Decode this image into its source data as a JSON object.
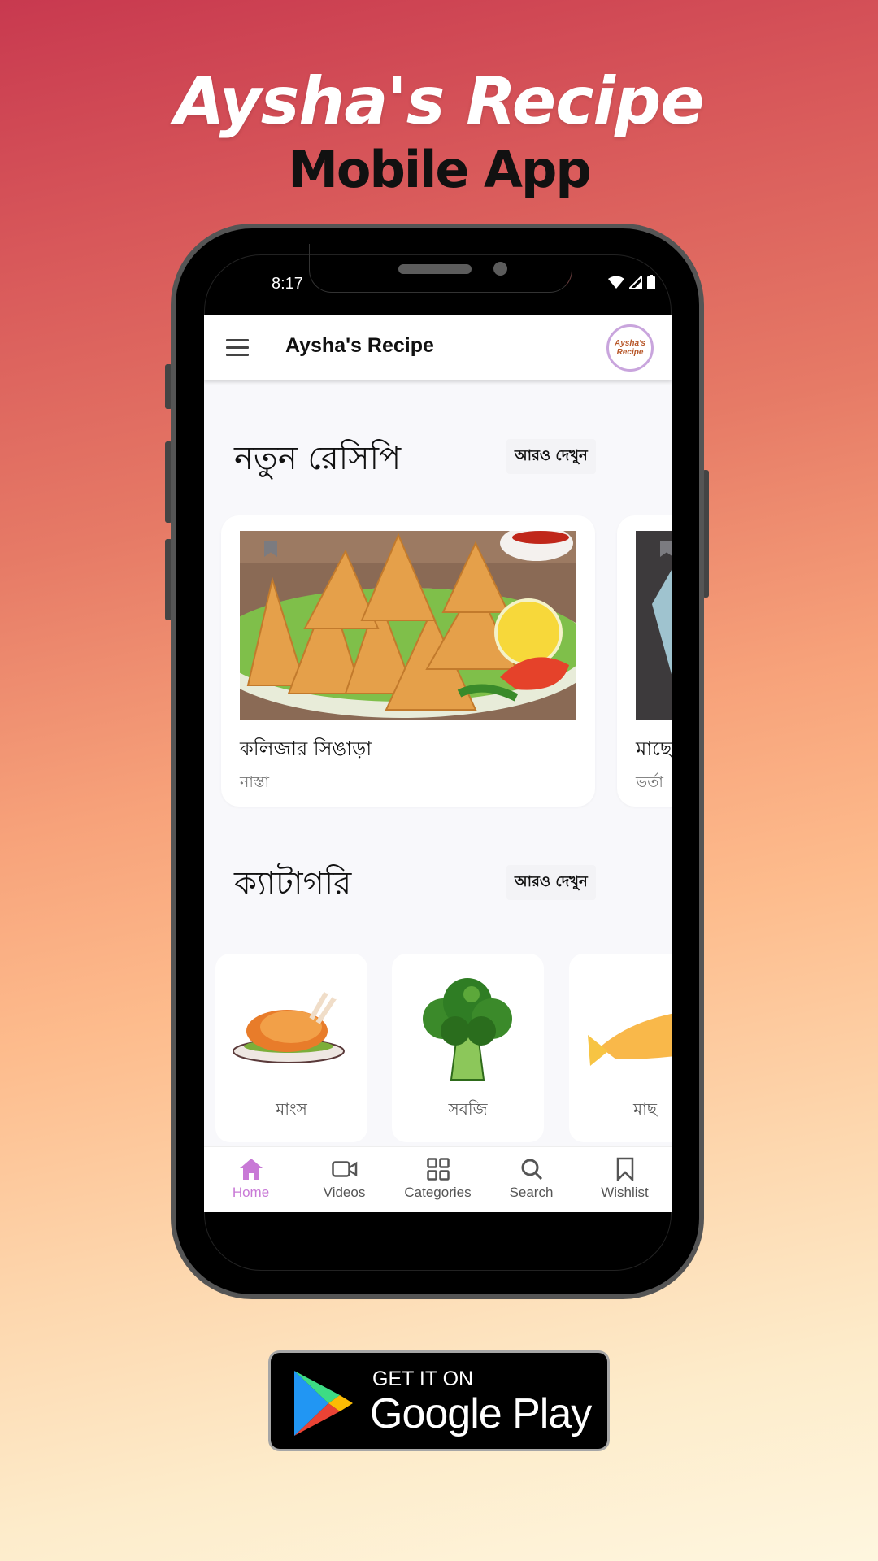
{
  "promo": {
    "title": "Aysha's Recipe",
    "subtitle": "Mobile App"
  },
  "status_bar": {
    "time": "8:17",
    "icons": [
      "wifi-icon",
      "signal-icon",
      "battery-icon"
    ]
  },
  "app_bar": {
    "menu_icon": "hamburger-menu-icon",
    "title": "Aysha's Recipe",
    "logo_line1": "Aysha's",
    "logo_line2": "Recipe"
  },
  "new_recipes": {
    "title": "নতুন রেসিপি",
    "see_more": "আরও দেখুন",
    "items": [
      {
        "name": "কলিজার সিঙাড়া",
        "category": "নাস্তা"
      },
      {
        "name": "মাছে",
        "category": "ভর্তা"
      }
    ]
  },
  "categories": {
    "title": "ক্যাটাগরি",
    "see_more": "আরও দেখুন",
    "items": [
      {
        "label": "মাংস",
        "icon": "roast-chicken-image"
      },
      {
        "label": "সবজি",
        "icon": "broccoli-image"
      },
      {
        "label": "মাছ",
        "icon": "fish-image"
      }
    ]
  },
  "bottom_nav": {
    "active_color": "#c879d6",
    "items": [
      {
        "label": "Home",
        "icon": "home-icon",
        "active": true
      },
      {
        "label": "Videos",
        "icon": "video-icon",
        "active": false
      },
      {
        "label": "Categories",
        "icon": "grid-icon",
        "active": false
      },
      {
        "label": "Search",
        "icon": "search-icon",
        "active": false
      },
      {
        "label": "Wishlist",
        "icon": "bookmark-icon",
        "active": false
      }
    ]
  },
  "store_badge": {
    "small": "GET IT ON",
    "big": "Google Play"
  }
}
